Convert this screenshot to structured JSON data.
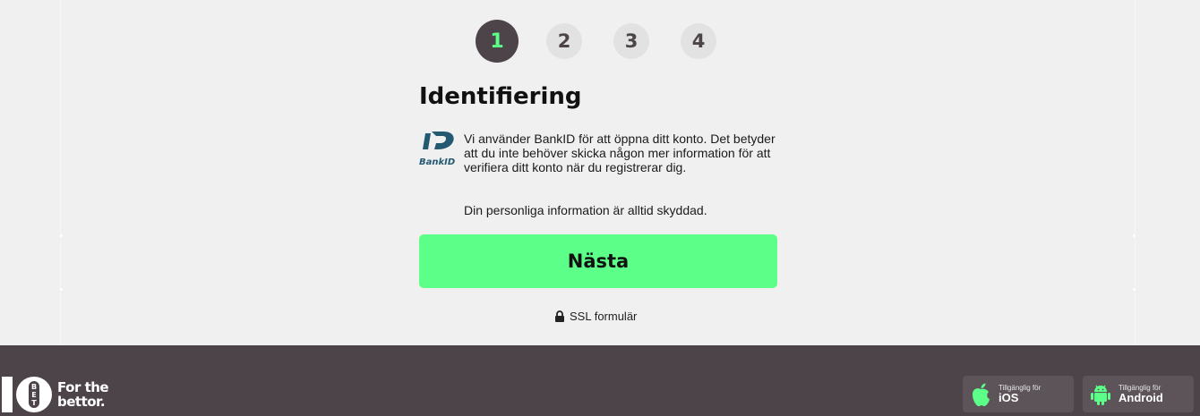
{
  "steps": [
    "1",
    "2",
    "3",
    "4"
  ],
  "active_step": 1,
  "title": "Identifiering",
  "bankid": {
    "logo_text": "BankID",
    "info_text": "Vi använder BankID för att öppna ditt konto. Det betyder att du inte behöver skicka någon mer information för att verifiera ditt konto när du registrerar dig.",
    "secure_text": "Din personliga information är alltid skyddad."
  },
  "next_button": "Nästa",
  "ssl_label": "SSL formulär",
  "footer": {
    "brand_logo_text": "10 BET",
    "brand_tagline_line1": "For the",
    "brand_tagline_line2": "bettor.",
    "ios": {
      "small": "Tillgänglig för",
      "big": "iOS"
    },
    "android": {
      "small": "Tillgänglig för",
      "big": "Android"
    }
  },
  "colors": {
    "accent": "#5cff88",
    "dark": "#4d4449",
    "background": "#f0f0f0",
    "bankid_blue": "#235971"
  },
  "icons": [
    "bankid-logo-icon",
    "lock-icon",
    "apple-icon",
    "android-icon",
    "tenbet-logo-icon"
  ]
}
